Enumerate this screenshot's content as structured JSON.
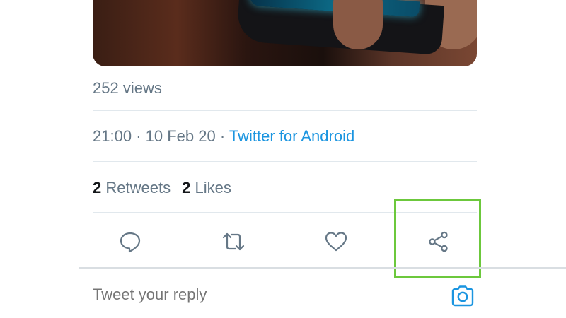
{
  "tweet": {
    "views": "252 views",
    "time": "21:00",
    "separator": "·",
    "date": "10 Feb 20",
    "source": "Twitter for Android",
    "retweets_count": "2",
    "retweets_label": "Retweets",
    "likes_count": "2",
    "likes_label": "Likes"
  },
  "actions": [
    {
      "name": "reply",
      "icon": "speech-bubble-icon"
    },
    {
      "name": "retweet",
      "icon": "retweet-arrows-icon"
    },
    {
      "name": "like",
      "icon": "heart-icon"
    },
    {
      "name": "share",
      "icon": "share-icon"
    }
  ],
  "reply": {
    "placeholder": "Tweet your reply",
    "camera_icon": "camera-icon"
  },
  "colors": {
    "text_grey": "#657786",
    "link_blue": "#1b95e0",
    "highlight_green": "#6cc83c",
    "divider": "#e1e8ed"
  }
}
